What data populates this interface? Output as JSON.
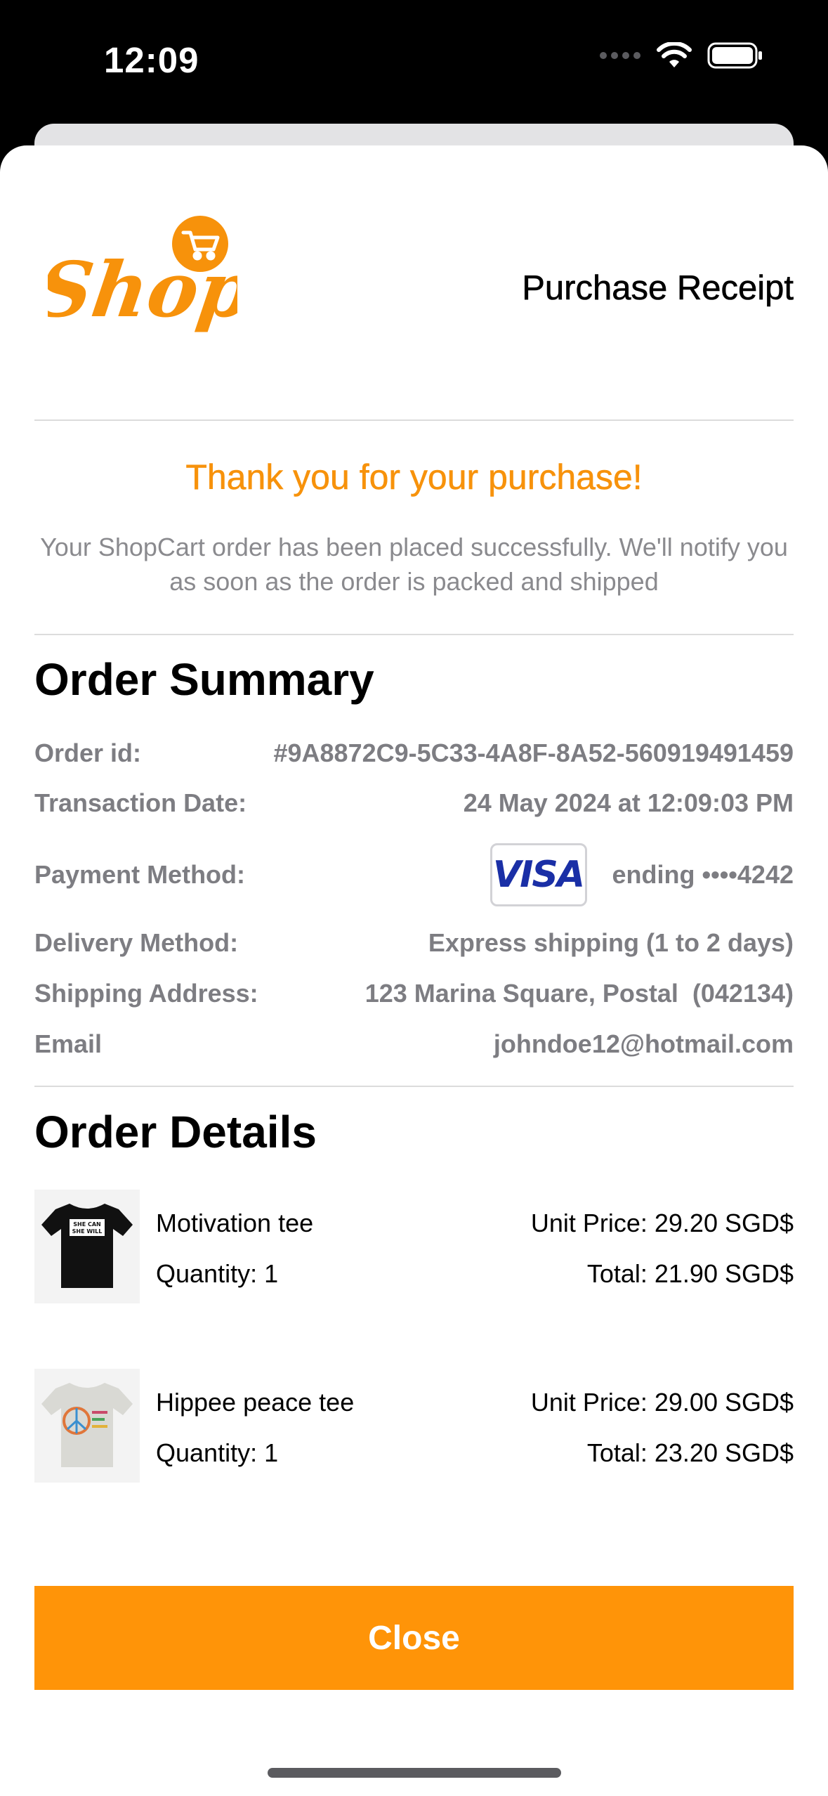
{
  "status_bar": {
    "time": "12:09",
    "icons": [
      "cellular-dots-icon",
      "wifi-icon",
      "battery-icon"
    ]
  },
  "header": {
    "logo_text": "Shop",
    "title": "Purchase Receipt"
  },
  "thanks": {
    "headline": "Thank you for your purchase!",
    "message": "Your ShopCart order has been placed successfully. We'll notify you as soon as the order is packed and shipped"
  },
  "order_summary": {
    "title": "Order Summary",
    "order_id_label": "Order id:",
    "order_id": "#9A8872C9-5C33-4A8F-8A52-560919491459",
    "date_label": "Transaction Date:",
    "date": "24 May 2024 at 12:09:03 PM",
    "payment_label": "Payment Method:",
    "card_brand": "VISA",
    "card_ending": "ending ••••4242",
    "delivery_label": "Delivery Method:",
    "delivery": "Express shipping (1 to 2 days)",
    "address_label": "Shipping Address:",
    "address": "123 Marina Square, Postal  (042134)",
    "email_label": "Email",
    "email": "johndoe12@hotmail.com"
  },
  "order_details": {
    "title": "Order Details",
    "items": [
      {
        "name": "Motivation tee",
        "quantity": "Quantity: 1",
        "unit_price": "Unit Price: 29.20 SGD$",
        "total": "Total: 21.90 SGD$",
        "shirt_text_line1": "SHE CAN",
        "shirt_text_line2": "SHE WILL"
      },
      {
        "name": "Hippee peace tee",
        "quantity": "Quantity: 1",
        "unit_price": "Unit Price: 29.00 SGD$",
        "total": "Total: 23.20 SGD$"
      }
    ]
  },
  "close_button": "Close",
  "colors": {
    "accent": "#ff9408",
    "headline": "#f7920b",
    "secondary_text": "#7d7d82"
  }
}
